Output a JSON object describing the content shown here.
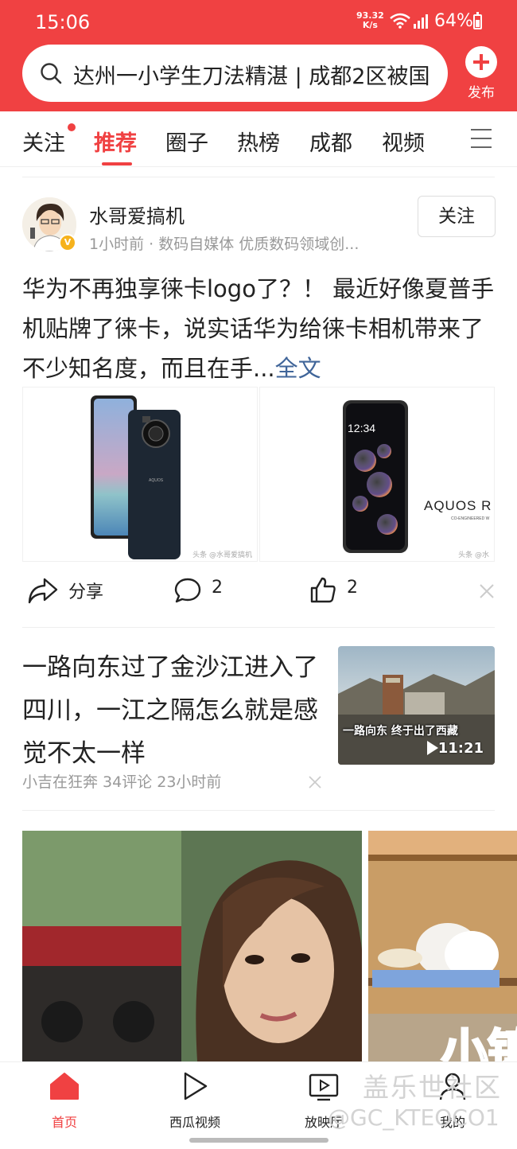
{
  "status_bar": {
    "time": "15:06",
    "net_speed_value": "93.32",
    "net_speed_unit": "K/s",
    "battery": "64%"
  },
  "header": {
    "search_text": "达州一小学生刀法精湛 | 成都2区被国",
    "publish_label": "发布",
    "accent_color": "#f04142"
  },
  "tabs": [
    {
      "label": "关注",
      "active": false,
      "dot": true
    },
    {
      "label": "推荐",
      "active": true
    },
    {
      "label": "圈子",
      "active": false
    },
    {
      "label": "热榜",
      "active": false
    },
    {
      "label": "成都",
      "active": false
    },
    {
      "label": "视频",
      "active": false
    }
  ],
  "post1": {
    "author": "水哥爱搞机",
    "meta": "1小时前 · 数码自媒体 优质数码领域创...",
    "follow_label": "关注",
    "text": "华为不再独享徕卡logo了？！ 最近好像夏普手机贴牌了徕卡，说实话华为给徕卡相机带来了不少知名度，而且在手...",
    "more_label": "全文",
    "images": [
      {
        "watermark": "头条 @水哥爱搞机",
        "brand": "AQUOS"
      },
      {
        "watermark": "头条 @水",
        "brand": "AQUOS R",
        "sub": "CO-ENGINEERED W",
        "clock": "12:34"
      }
    ],
    "actions": {
      "share_label": "分享",
      "comments": "2",
      "likes": "2"
    }
  },
  "post2": {
    "title": "一路向东过了金沙江进入了四川，一江之隔怎么就是感觉不太一样",
    "meta": "小吉在狂奔   34评论   23小时前",
    "thumb_caption": "一路向东    终于出了西藏",
    "duration": "11:21"
  },
  "feed_img_2_text": "小镇",
  "bottom_nav": [
    {
      "label": "首页",
      "icon": "home-icon",
      "active": true
    },
    {
      "label": "西瓜视频",
      "icon": "play-icon",
      "active": false
    },
    {
      "label": "放映厅",
      "icon": "tv-icon",
      "active": false
    },
    {
      "label": "我的",
      "icon": "profile-icon",
      "active": false
    }
  ],
  "overlay": {
    "brand": "盖乐世社区",
    "handle": "@GC_KTEOCO1"
  }
}
